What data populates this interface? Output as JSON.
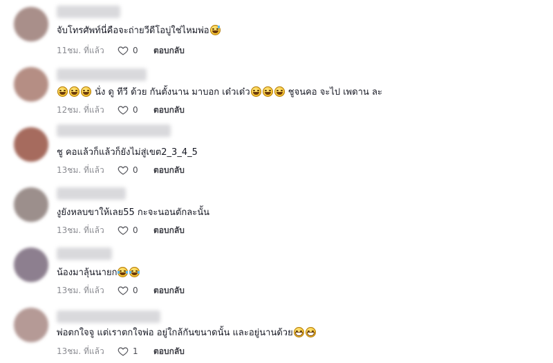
{
  "comments": [
    {
      "text": "จับโทรศัพท์นี่คือจะถ่ายวีดีโอบู่ใช่ไหมพ่อ",
      "trailing_emojis": [
        "sweat-smile-emoji"
      ],
      "time": "11ชม. ที่แล้ว",
      "likes": "0",
      "reply_label": "ตอบกลับ",
      "avatar_color": "#a98f8a"
    },
    {
      "text_prefix_emojis": [
        "grin-emoji",
        "grin-emoji",
        "grin-emoji"
      ],
      "text": " นั่ง ดู ทีวี ด้วย กันตั้งนาน มาบอก เด๋วเด๋ว",
      "mid_emojis": [
        "grin-emoji",
        "grin-emoji",
        "grin-emoji"
      ],
      "text_suffix": " ชูจนคอ จะไป เพดาน ละ",
      "time": "12ชม. ที่แล้ว",
      "likes": "0",
      "reply_label": "ตอบกลับ",
      "avatar_color": "#b58e84"
    },
    {
      "text": "ชู คอแล้วก็แล้วก็ยังไม่สู่เขต2_3_4_5",
      "time": "13ชม. ที่แล้ว",
      "likes": "0",
      "reply_label": "ตอบกลับ",
      "avatar_color": "#a66b5e"
    },
    {
      "text": "งูยังหลบขาให้เลย55 กะจะนอนตักละนั้น",
      "time": "13ชม. ที่แล้ว",
      "likes": "0",
      "reply_label": "ตอบกลับ",
      "avatar_color": "#9c8f8c"
    },
    {
      "text": "น้องมาลุ้นนายก",
      "trailing_emojis": [
        "tears-joy-emoji",
        "tears-joy-emoji"
      ],
      "time": "13ชม. ที่แล้ว",
      "likes": "0",
      "reply_label": "ตอบกลับ",
      "avatar_color": "#8d7f8f"
    },
    {
      "text": "พ่อตกใจจู แต่เราตกใจพ่อ อยู่ใกล้กันขนาดนั้น และอยู่นานด้วย",
      "trailing_emojis": [
        "grimace-emoji",
        "grimace-emoji"
      ],
      "time": "13ชม. ที่แล้ว",
      "likes": "1",
      "reply_label": "ตอบกลับ",
      "avatar_color": "#b59a96"
    }
  ],
  "colors": {
    "text": "#161823",
    "meta": "#8a8b91",
    "reply": "#3c3d44"
  }
}
